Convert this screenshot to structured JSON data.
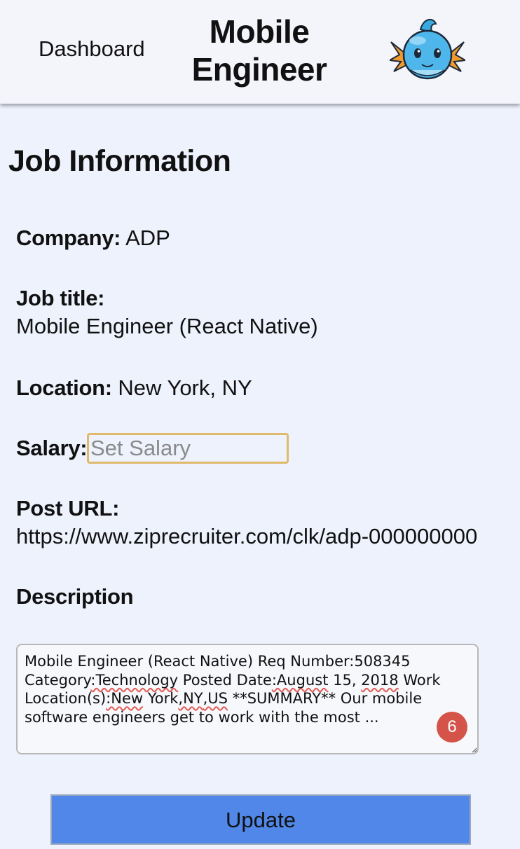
{
  "header": {
    "nav_label": "Dashboard",
    "title_line1": "Mobile",
    "title_line2": "Engineer",
    "avatar_icon": "mudkip-avatar-icon"
  },
  "main": {
    "section_title": "Job Information",
    "company": {
      "label": "Company:",
      "value": "ADP"
    },
    "job_title": {
      "label": "Job title:",
      "value": "Mobile Engineer (React Native)"
    },
    "location": {
      "label": "Location:",
      "value": "New York, NY"
    },
    "salary": {
      "label": "Salary:",
      "value": "",
      "placeholder": "Set Salary"
    },
    "post_url": {
      "label": "Post URL:",
      "value": "https://www.ziprecruiter.com/clk/adp-000000000"
    },
    "description": {
      "label": "Description",
      "seg": [
        "Mobile Engineer (React Native) Req Number:508345 Category",
        ":Technology",
        " Posted Date",
        ":August",
        " 15, ",
        "2018",
        " Work Location(s)",
        ":New",
        " York",
        ",NY",
        ",US",
        " **SUMMARY** Our mobile software engineers get to work with the most ..."
      ],
      "badge_count": "6"
    },
    "update_label": "Update"
  },
  "colors": {
    "background": "#eef2fd",
    "header_bg": "#f4f4fb",
    "button_bg": "#5087e8",
    "input_focus_border": "#e0b96c",
    "spell_underline": "#e35d57",
    "badge_bg": "#d5544a"
  }
}
